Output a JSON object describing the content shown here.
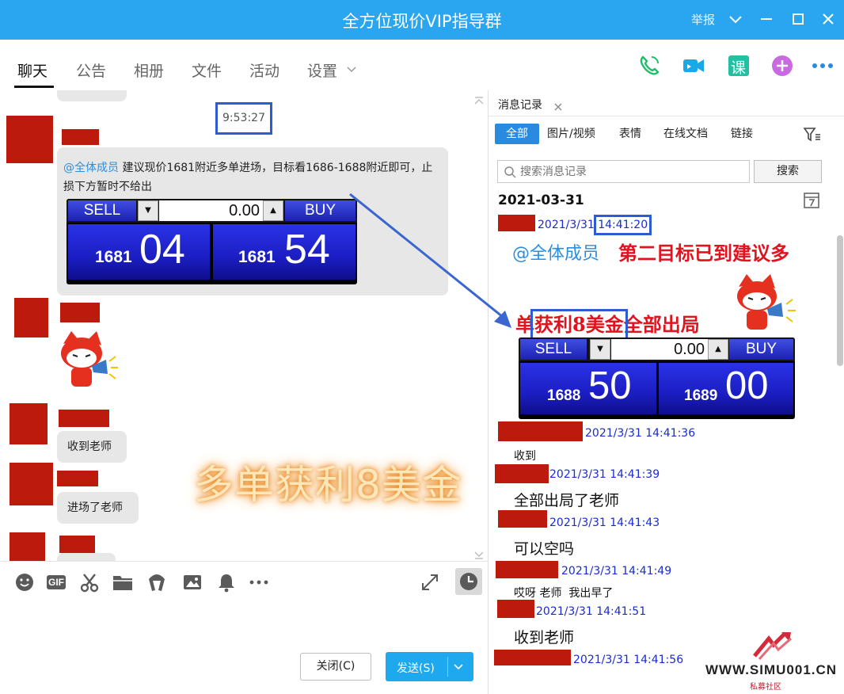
{
  "window": {
    "title": "全方位现价VIP指导群",
    "report_label": "举报"
  },
  "nav": {
    "tabs": [
      "聊天",
      "公告",
      "相册",
      "文件",
      "活动",
      "设置"
    ],
    "active": "聊天",
    "tools": [
      "phone-call-icon",
      "video-call-icon",
      "course-icon",
      "add-app-icon",
      "more-icon"
    ],
    "course_label": "课"
  },
  "chat": {
    "time_marker": "9:53:27",
    "teacher_message": {
      "mention": "@全体成员",
      "text": " 建议现价1681附近多单进场，目标看1686-1688附近即可，止损下方暂时不给出"
    },
    "ticker_left": {
      "sell_label": "SELL",
      "buy_label": "BUY",
      "spread": "0.00",
      "sell_small": "1681",
      "sell_big": "04",
      "buy_small": "1681",
      "buy_big": "54"
    },
    "reply_1": "收到老师",
    "reply_2": "进场了老师",
    "overlay_caption": "多单获利8美金"
  },
  "composer": {
    "tools": [
      "emoji-icon",
      "gif-icon",
      "screenshot-scissors-icon",
      "folder-icon",
      "music-icon",
      "image-icon",
      "bell-icon",
      "more-icon"
    ],
    "gif_label": "GIF",
    "close_label": "关闭(C)",
    "send_label": "发送(S)"
  },
  "history": {
    "tab_title": "消息记录",
    "filters": [
      "全部",
      "图片/视频",
      "表情",
      "在线文档",
      "链接"
    ],
    "active_filter": "全部",
    "search_placeholder": "搜索消息记录",
    "search_button": "搜索",
    "date": "2021-03-31",
    "first_post": {
      "date_part": "2021/3/31 ",
      "time_part": "14:41:20",
      "mention": "@全体成员",
      "headline": "第二目标已到建议多",
      "line2_a": "单",
      "line2_b": "获利8美金",
      "line2_c": "全部出局"
    },
    "ticker_right": {
      "sell_label": "SELL",
      "buy_label": "BUY",
      "spread": "0.00",
      "sell_small": "1688",
      "sell_big": "50",
      "buy_small": "1689",
      "buy_big": "00"
    },
    "entries": [
      {
        "time": "2021/3/31 14:41:36",
        "text": "收到"
      },
      {
        "time": "2021/3/31 14:41:39",
        "text": "全部出局了老师"
      },
      {
        "time": "2021/3/31 14:41:43",
        "text": "可以空吗"
      },
      {
        "time": "2021/3/31 14:41:49",
        "text": "哎呀 老师  我出早了"
      },
      {
        "time": "2021/3/31 14:41:51",
        "text": "收到老师"
      },
      {
        "time": "2021/3/31 14:41:56",
        "text": ""
      }
    ]
  },
  "watermark": {
    "site": "WWW.SIMU001.CN",
    "sub": "私募社区"
  },
  "colors": {
    "titlebar": "#2aa6f0",
    "redaction": "#bb1a0c",
    "highlight_box": "#2d5bd1",
    "timestamp": "#1a2bd1",
    "headline_red": "#e0141e",
    "mention_blue": "#2c8ede"
  }
}
